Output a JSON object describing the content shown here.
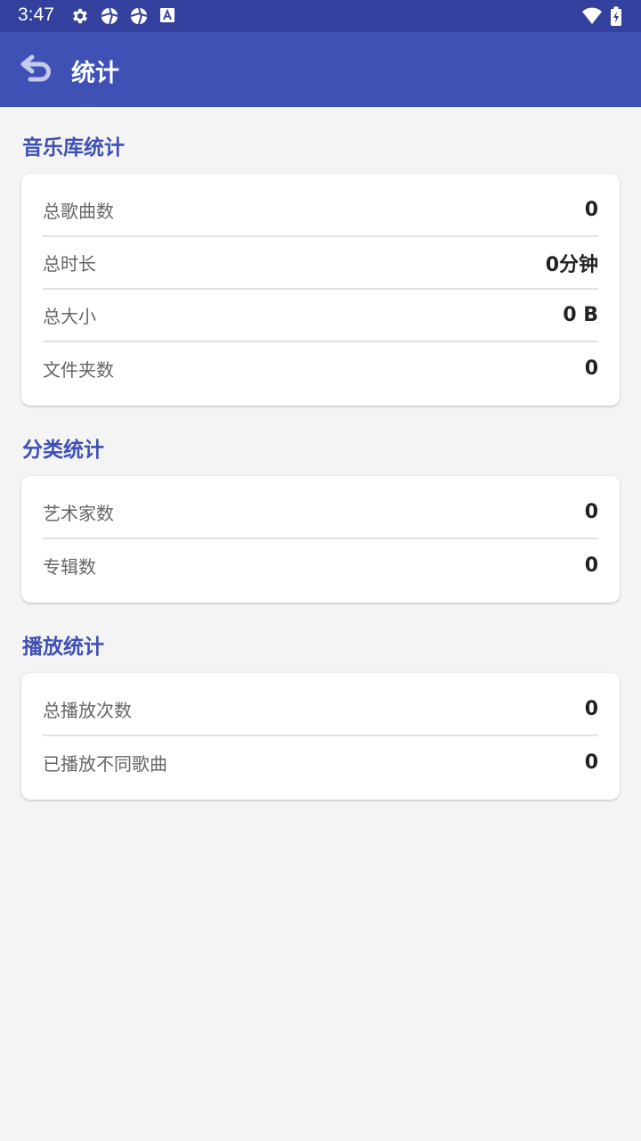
{
  "status_bar": {
    "time": "3:47",
    "left_icons": [
      "gear-icon",
      "aperture-icon",
      "aperture-icon",
      "font-a-icon"
    ],
    "right_icons": [
      "wifi-icon",
      "battery-charging-icon"
    ]
  },
  "app_bar": {
    "title": "统计",
    "back_icon": "back-arrow-icon",
    "color": "#3f51b5"
  },
  "sections": [
    {
      "title": "音乐库统计",
      "rows": [
        {
          "label": "总歌曲数",
          "value": "0"
        },
        {
          "label": "总时长",
          "value": "0分钟"
        },
        {
          "label": "总大小",
          "value": "0 B"
        },
        {
          "label": "文件夹数",
          "value": "0"
        }
      ]
    },
    {
      "title": "分类统计",
      "rows": [
        {
          "label": "艺术家数",
          "value": "0"
        },
        {
          "label": "专辑数",
          "value": "0"
        }
      ]
    },
    {
      "title": "播放统计",
      "rows": [
        {
          "label": "总播放次数",
          "value": "0"
        },
        {
          "label": "已播放不同歌曲",
          "value": "0"
        }
      ]
    }
  ],
  "colors": {
    "accent": "#3f51b5",
    "status_bar": "#33409e",
    "background": "#f4f4f4"
  }
}
